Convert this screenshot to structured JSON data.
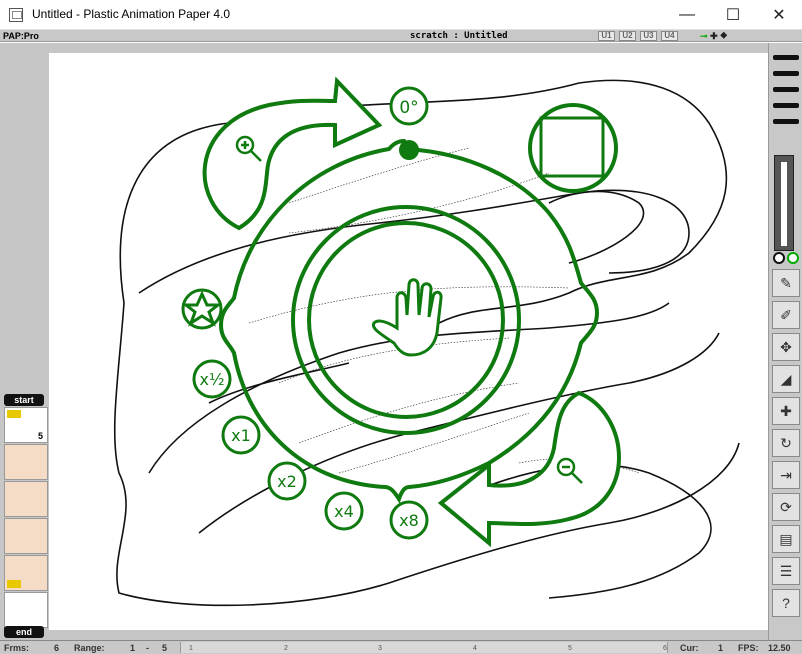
{
  "window": {
    "title": "Untitled - Plastic Animation Paper 4.0",
    "minimize": "—",
    "maximize": "☐",
    "close": "✕"
  },
  "topbar": {
    "brand": "PAP:Pro",
    "scratch_title": "scratch : Untitled",
    "user_buttons": [
      "U1",
      "U2",
      "U3",
      "U4"
    ]
  },
  "navigation_wheel": {
    "rotation_label": "0°",
    "zoom_levels": [
      "x½",
      "x1",
      "x2",
      "x4",
      "x8"
    ],
    "accent_color": "#0f7a0f",
    "center_icon": "hand-icon",
    "zoom_in_icon": "zoom-in-icon",
    "zoom_out_icon": "zoom-out-icon",
    "star_icon": "star-icon",
    "fit_icon": "fit-frame-icon"
  },
  "frame_strip": {
    "start_label": "start",
    "end_label": "end",
    "current_frame": "5"
  },
  "right_toolbar": {
    "tools": [
      "brush-tool-icon",
      "eraser-tool-icon",
      "transform-tool-icon",
      "light-table-icon",
      "add-frame-icon",
      "rotate-icon",
      "step-forward-icon",
      "loop-icon",
      "save-icon",
      "layers-icon",
      "help-icon"
    ],
    "help_label": "?"
  },
  "status": {
    "frames_label": "Frms:",
    "frames_value": "6",
    "range_label": "Range:",
    "range_start": "1",
    "range_sep": "-",
    "range_end": "5",
    "timeline_ticks": [
      "1",
      "2",
      "3",
      "4",
      "5",
      "6"
    ],
    "cur_label": "Cur:",
    "cur_value": "1",
    "fps_label": "FPS:",
    "fps_value": "12.50"
  }
}
